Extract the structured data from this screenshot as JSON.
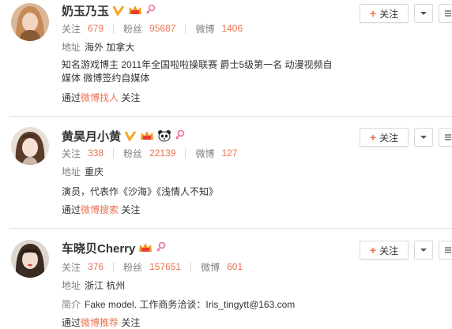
{
  "labels": {
    "follow": "关注",
    "fans": "粉丝",
    "weibo": "微博",
    "address": "地址",
    "intro": "简介",
    "via": "通过",
    "follow_btn": "关注"
  },
  "users": [
    {
      "name": "奶玉乃玉",
      "following": "679",
      "fans": "95687",
      "weibo": "1406",
      "address": "海外 加拿大",
      "description": "知名游戏博主 2011年全国啦啦操联赛 爵士5级第一名 动漫视频自媒体 微博签约自媒体",
      "via_link": "微博找人",
      "via_suffix": "关注"
    },
    {
      "name": "黄昊月小黄",
      "following": "338",
      "fans": "22139",
      "weibo": "127",
      "address": "重庆",
      "description": "演员，代表作《沙海》《浅情人不知》",
      "via_link": "微博搜索",
      "via_suffix": "关注"
    },
    {
      "name": "车晓贝Cherry",
      "following": "376",
      "fans": "157651",
      "weibo": "601",
      "address": "浙江 杭州",
      "intro": "Fake model. 工作商务洽谈：Iris_tingytt@163.com",
      "via_link": "微博推荐",
      "via_suffix": "关注"
    }
  ],
  "colors": {
    "accent": "#eb7350",
    "verified": "#f5a623",
    "female": "#e96fa0"
  }
}
